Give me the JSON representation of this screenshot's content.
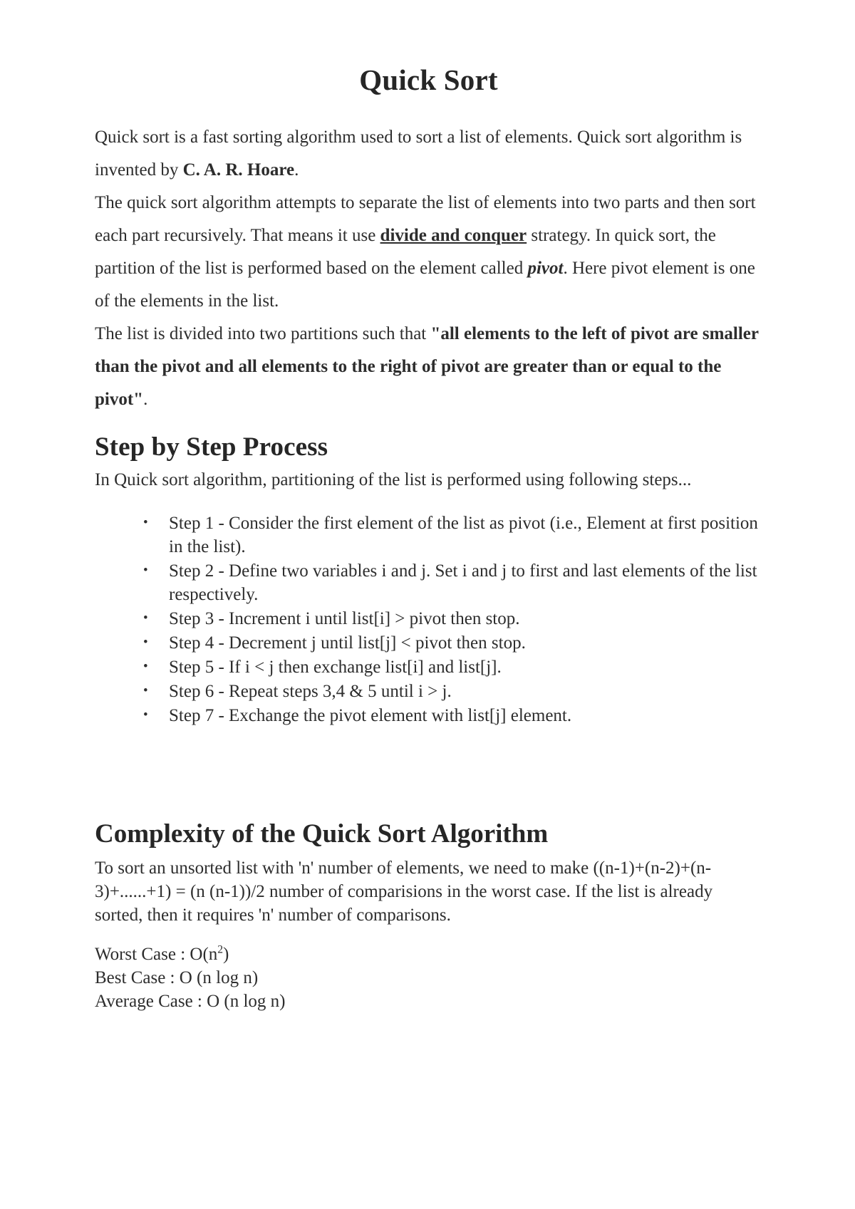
{
  "document": {
    "title": "Quick Sort",
    "intro": {
      "para1_before_bold": "Quick sort is a fast sorting algorithm used to sort a list of elements. Quick sort algorithm is invented by ",
      "para1_bold": "C. A. R. Hoare",
      "para1_after_bold": ".",
      "para2_seg1": "The quick sort algorithm attempts to separate the list of elements into two parts and then sort each part recursively. That means it use ",
      "para2_bold_underline": "divide and conquer",
      "para2_seg2": " strategy. In quick sort, the partition of the list is performed based on the element called ",
      "para2_bold_italic": "pivot",
      "para2_seg3": ". Here pivot element is one of the elements in the list.",
      "para3_seg1": "The list is divided into two partitions such that ",
      "para3_bold": "\"all elements to the left of pivot are smaller than the pivot and all elements to the right of pivot are greater than or equal to the pivot\"",
      "para3_seg2": "."
    },
    "step_section": {
      "heading": "Step by Step Process",
      "lead": "In Quick sort algorithm, partitioning of the list is performed using following steps...",
      "steps": [
        "Step 1 - Consider the first element of the list as pivot (i.e., Element at first position in the list).",
        "Step 2 - Define two variables i and j. Set i and j to first and last elements of the list respectively.",
        "Step 3 - Increment i until list[i] > pivot then stop.",
        "Step 4 - Decrement j until list[j] < pivot then stop.",
        "Step 5 - If i < j then exchange list[i] and list[j].",
        "Step 6 - Repeat steps 3,4 & 5 until i > j.",
        "Step 7 - Exchange the pivot element with list[j] element."
      ]
    },
    "complexity_section": {
      "heading": "Complexity of the Quick Sort Algorithm",
      "para": "To sort an unsorted list with 'n' number of elements, we need to make ((n-1)+(n-2)+(n-3)+......+1) = (n (n-1))/2 number of comparisions in the worst case. If the list is already sorted, then it requires 'n' number of comparisons.",
      "worst_case_label": "Worst Case : O(n",
      "worst_case_exponent": "2",
      "worst_case_suffix": ")",
      "best_case": "Best Case : O (n log n)",
      "average_case": "Average Case : O (n log n)"
    }
  }
}
